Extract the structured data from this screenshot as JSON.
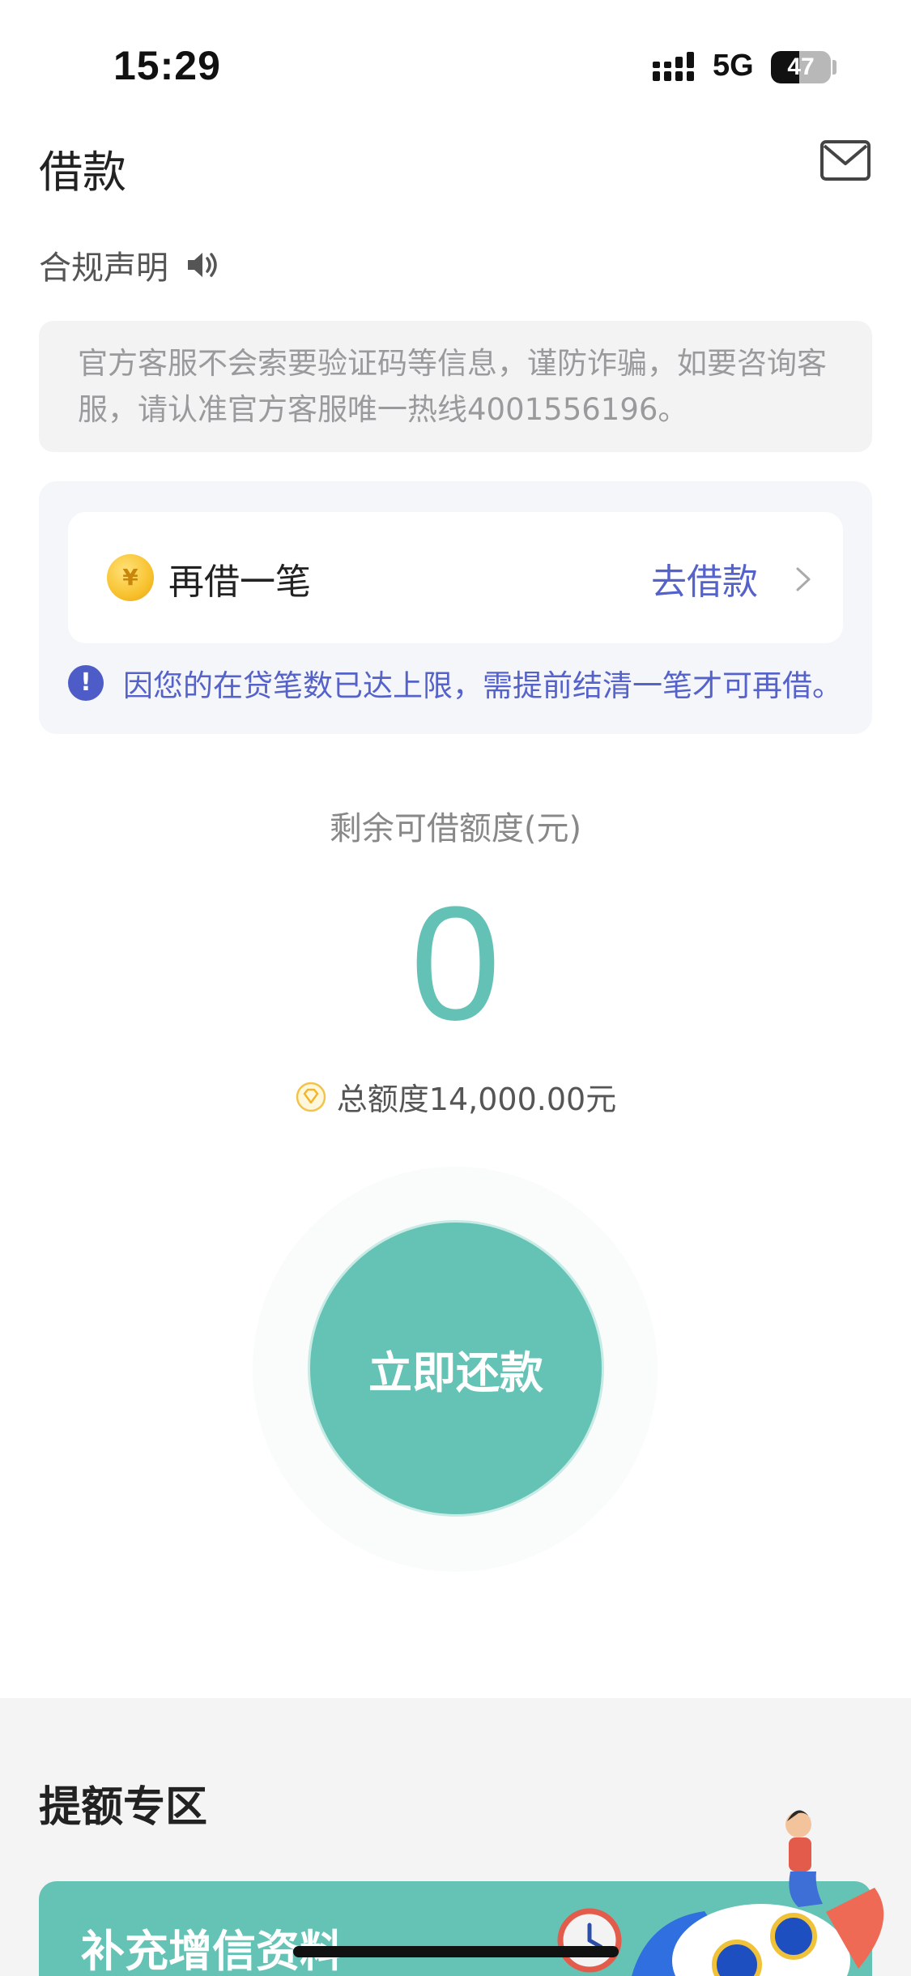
{
  "status_bar": {
    "time": "15:29",
    "network": "5G",
    "battery": "47",
    "battery_level": 0.47
  },
  "header": {
    "title": "借款",
    "mail_icon": "mail-icon"
  },
  "compliance": {
    "label": "合规声明",
    "icon": "speaker-icon"
  },
  "notice": {
    "text": "官方客服不会索要验证码等信息，谨防诈骗，如要咨询客服，请认准官方客服唯一热线4001556196。"
  },
  "borrow_card": {
    "label": "再借一笔",
    "action": "去借款",
    "warning": "因您的在贷笔数已达上限，需提前结清一笔才可再借。",
    "coin_symbol": "¥"
  },
  "quota": {
    "label": "剩余可借额度(元)",
    "value": "0",
    "total": "总额度14,000.00元"
  },
  "repay": {
    "label": "立即还款"
  },
  "boost": {
    "title": "提额专区",
    "card_title": "补充增信资料"
  },
  "colors": {
    "accent": "#65c3b6",
    "link": "#5562c9"
  }
}
